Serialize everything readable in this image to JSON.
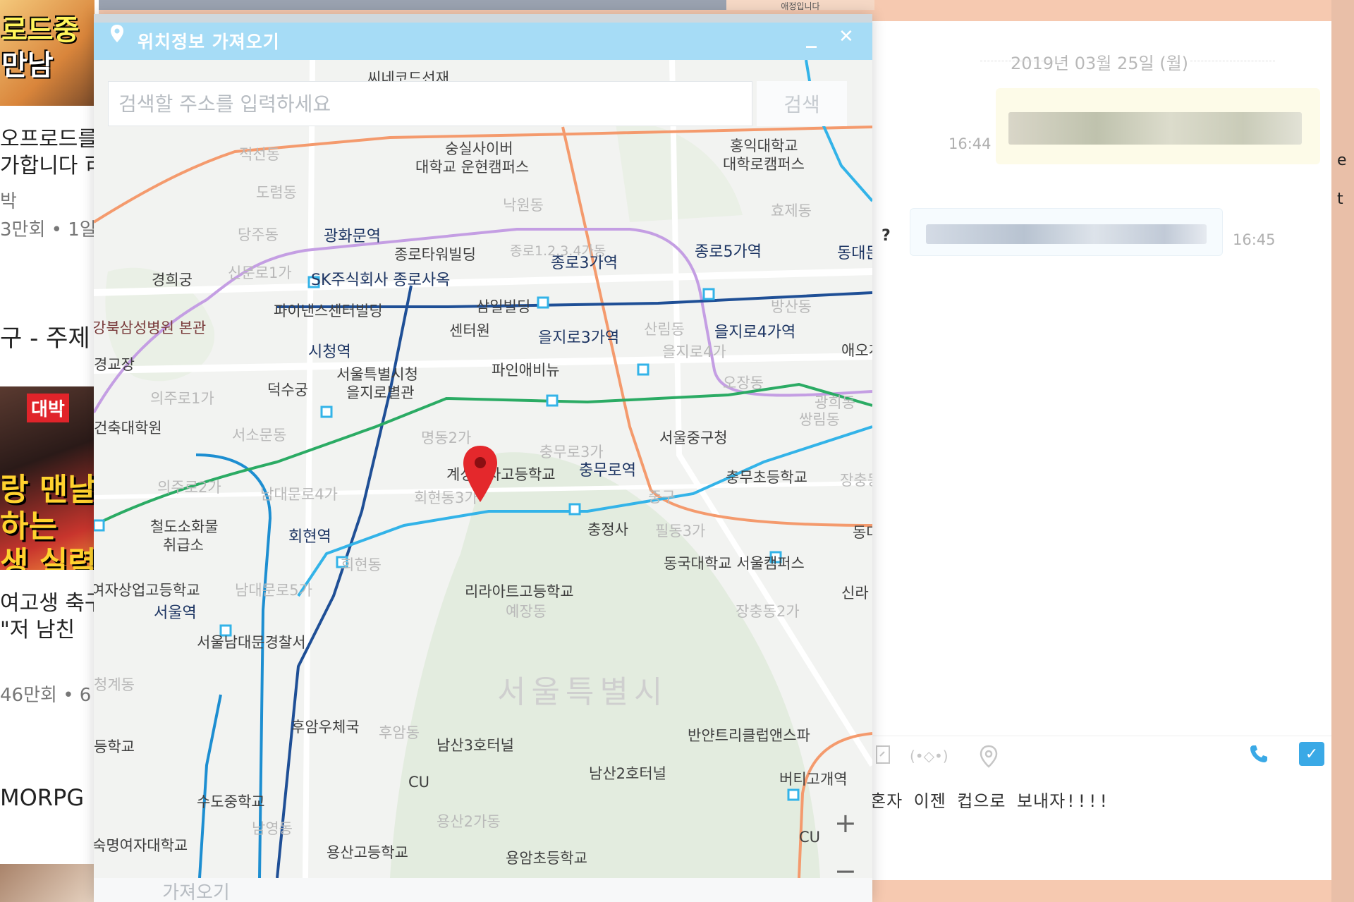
{
  "feed": {
    "thumb1_line1": "로드중",
    "thumb1_line2": "만남",
    "item1_title_line1": "오프로드를",
    "item1_title_line2": "가합니다 可",
    "item1_channel": "박",
    "item1_meta": "3만회 • 1일",
    "item2_title": "구 - 주제",
    "thumb2_badge": "대박",
    "thumb2_line1": "랑 맨날",
    "thumb2_line2": "하는",
    "thumb2_line3": "생 실력!",
    "item3_title_line1": "여고생 축구",
    "item3_title_line2": "\"저 남친",
    "item3_meta": "46만회 • 6",
    "item4_title": "MORPG"
  },
  "background_top": "애정입니다",
  "chat": {
    "date": "2019년 03월 25일 (월)",
    "messages": [
      {
        "direction": "out",
        "time": "16:44"
      },
      {
        "direction": "in",
        "time": "16:45"
      }
    ],
    "question_mark": "?",
    "input_text": "혼자 이젠 컵으로 보내자!!!!",
    "emoticon_label": "(•◇•)"
  },
  "dialog": {
    "title": "위치정보 가져오기",
    "minimize_label": "_",
    "close_label": "✕",
    "search_placeholder": "검색할 주소를 입력하세요",
    "search_button": "검색",
    "fetch_button": "가져오기",
    "zoom_in": "+",
    "zoom_out": "−"
  },
  "map": {
    "city_label": "서울특별시",
    "labels": [
      "씨네코드선재",
      "숭실사이버",
      "대학교 운현캠퍼스",
      "홍익대학교",
      "대학로캠퍼스",
      "적선동",
      "도렴동",
      "낙원동",
      "효제동",
      "종로5가역",
      "동대문",
      "광화문역",
      "종로타워빌딩",
      "종로1.2.3.4가동",
      "종로3가역",
      "당주동",
      "신문로1가",
      "SK주식회사 종로사옥",
      "경희궁",
      "파이낸스센터빌딩",
      "삼일빌딩",
      "방산동",
      "센터원",
      "을지로3가역",
      "산림동",
      "을지로4가역",
      "강북삼성병원 본관",
      "시청역",
      "을지로4가",
      "애오개",
      "서울특별시청",
      "을지로별관",
      "파인애비뉴",
      "덕수궁",
      "오장동",
      "광희동",
      "쌍림동",
      "명동2가",
      "충무로3가",
      "서울중구청",
      "충무로역",
      "충무초등학교",
      "건축대학원",
      "서소문동",
      "계성여자고등학교",
      "회현동3가",
      "의주로2가",
      "남대문로4가",
      "중구",
      "충정사",
      "필동3가",
      "철도소화물",
      "취급소",
      "회현역",
      "회현동",
      "동국대학교 서울캠퍼스",
      "리라아트고등학교",
      "예장동",
      "여자상업고등학교",
      "서울역",
      "남대문로5가",
      "장충동2가",
      "서울남대문경찰서",
      "후암우체국",
      "후암동",
      "남산3호터널",
      "반얀트리클럽앤스파",
      "남산2호터널",
      "CU",
      "버티고개역",
      "수도중학교",
      "남영동",
      "용산2가동",
      "용산고등학교",
      "용암초등학교",
      "숙명여자대학교",
      "신라",
      "동대입구",
      "장충동",
      "경교장",
      "등학교",
      "의주로1가",
      "청계동",
      "CU"
    ]
  }
}
